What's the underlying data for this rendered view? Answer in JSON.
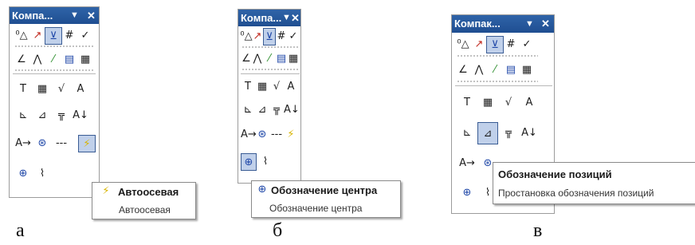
{
  "panels": {
    "a": {
      "title": "Компа...",
      "caption": "а"
    },
    "b": {
      "title": "Компа...",
      "caption": "б"
    },
    "c": {
      "title": "Компак...",
      "caption": "в"
    }
  },
  "titlebar_controls": {
    "menu_glyph": "▼",
    "close_glyph": "✕"
  },
  "tool_icons": {
    "row1": [
      "dimension-point-icon",
      "dimension-line-icon",
      "dimension-view-icon",
      "hatch-grid-icon",
      "build-icon"
    ],
    "row2": [
      "linear-dimension-icon",
      "angular-dimension-icon",
      "color-dimension-icon",
      "frame-icon",
      "table-icon"
    ],
    "row3": [
      "text-icon",
      "table-text-icon",
      "roughness-icon",
      "datum-icon"
    ],
    "row4": [
      "leader-icon",
      "base-icon",
      "tolerance-frame-icon",
      "sort-icon"
    ],
    "row5": [
      "arrow-view-icon",
      "section-icon",
      "centerline-icon",
      "auto-axis-icon"
    ],
    "row6": [
      "center-mark-icon",
      "wave-line-icon"
    ]
  },
  "glyphs": {
    "row1": [
      "⁰△",
      "↗",
      "⊻",
      "#",
      "✓"
    ],
    "row2": [
      "∠",
      "⋀",
      "⁄",
      "▤",
      "▦"
    ],
    "row3": [
      "T",
      "▦",
      "√",
      "A"
    ],
    "row4": [
      "⊾",
      "⊿",
      "╦",
      "A↓"
    ],
    "row5": [
      "A→",
      "⊛",
      "---",
      "⚡"
    ],
    "row6": [
      "⊕",
      "⌇"
    ]
  },
  "tooltips": {
    "a": {
      "title": "Автоосевая",
      "subtitle": "Автоосевая"
    },
    "b": {
      "title": "Обозначение центра",
      "subtitle": "Обозначение центра"
    },
    "c": {
      "title": "Обозначение позиций",
      "subtitle": "Простановка обозначения позиций"
    }
  },
  "colors": {
    "title_bar": "#1f4e91",
    "selected_bg": "#c0d0ea",
    "selected_border": "#3a5c94"
  }
}
